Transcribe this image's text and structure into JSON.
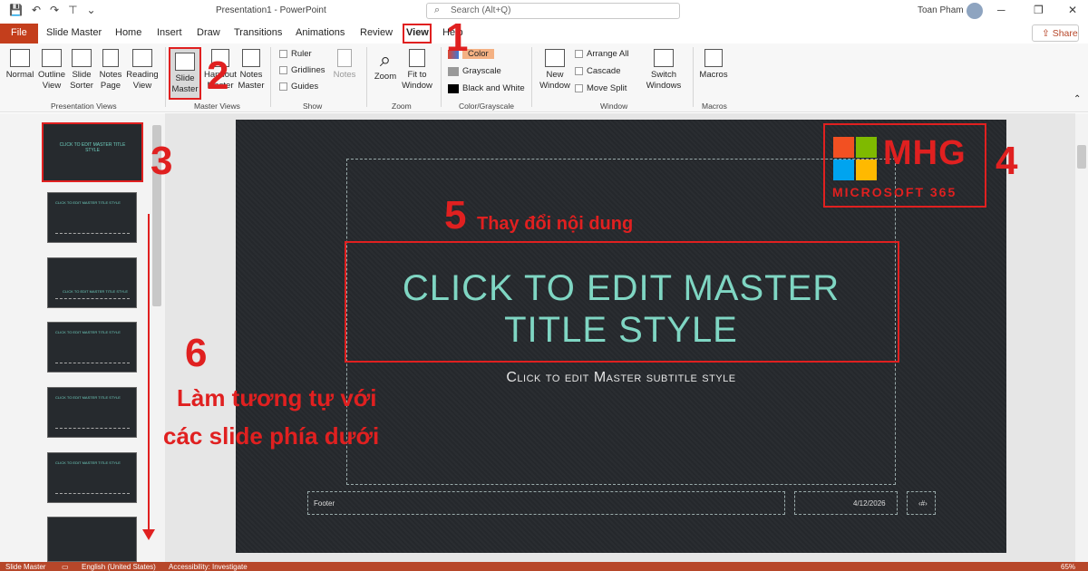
{
  "titlebar": {
    "doc_title": "Presentation1 - PowerPoint",
    "search_placeholder": "Search (Alt+Q)",
    "user_name": "Toan Pham"
  },
  "tabs": [
    "File",
    "Slide Master",
    "Home",
    "Insert",
    "Draw",
    "Transitions",
    "Animations",
    "Review",
    "View",
    "Help"
  ],
  "share_label": "Share",
  "ribbon": {
    "presentation_views": {
      "label": "Presentation Views",
      "buttons": [
        "Normal",
        "Outline View",
        "Slide Sorter",
        "Notes Page",
        "Reading View"
      ]
    },
    "master_views": {
      "label": "Master Views",
      "buttons": [
        "Slide Master",
        "Handout Master",
        "Notes Master"
      ]
    },
    "show": {
      "label": "Show",
      "checks": [
        "Ruler",
        "Gridlines",
        "Guides"
      ],
      "notes": "Notes"
    },
    "zoom": {
      "label": "Zoom",
      "buttons": [
        "Zoom",
        "Fit to Window"
      ]
    },
    "color": {
      "label": "Color/Grayscale",
      "items": [
        "Color",
        "Grayscale",
        "Black and White"
      ]
    },
    "window": {
      "label": "Window",
      "new_window": "New Window",
      "items": [
        "Arrange All",
        "Cascade",
        "Move Split"
      ],
      "switch": "Switch Windows"
    },
    "macros": {
      "label": "Macros",
      "button": "Macros"
    }
  },
  "slide": {
    "title": "CLICK TO EDIT MASTER TITLE STYLE",
    "subtitle": "Click to edit Master subtitle style",
    "footer": "Footer",
    "date": "4/12/2026",
    "page_num": "‹#›"
  },
  "thumb_title": "CLICK TO EDIT MASTER TITLE STYLE",
  "logo": {
    "name": "MHG",
    "sub": "MICROSOFT 365"
  },
  "annotations": {
    "step1": "1",
    "step2": "2",
    "step3": "3",
    "step4": "4",
    "step5": "5",
    "step5_text": "Thay đổi nội dung",
    "step6": "6",
    "step6_line1": "Làm tương tự với",
    "step6_line2": "các slide phía dưới"
  },
  "status": {
    "view": "Slide Master",
    "language": "English (United States)",
    "accessibility": "Accessibility: Investigate",
    "zoom": "65%"
  },
  "colors": {
    "accent": "#c43e1c",
    "annotation_red": "#e02020",
    "title_teal": "#7fd6c3"
  }
}
